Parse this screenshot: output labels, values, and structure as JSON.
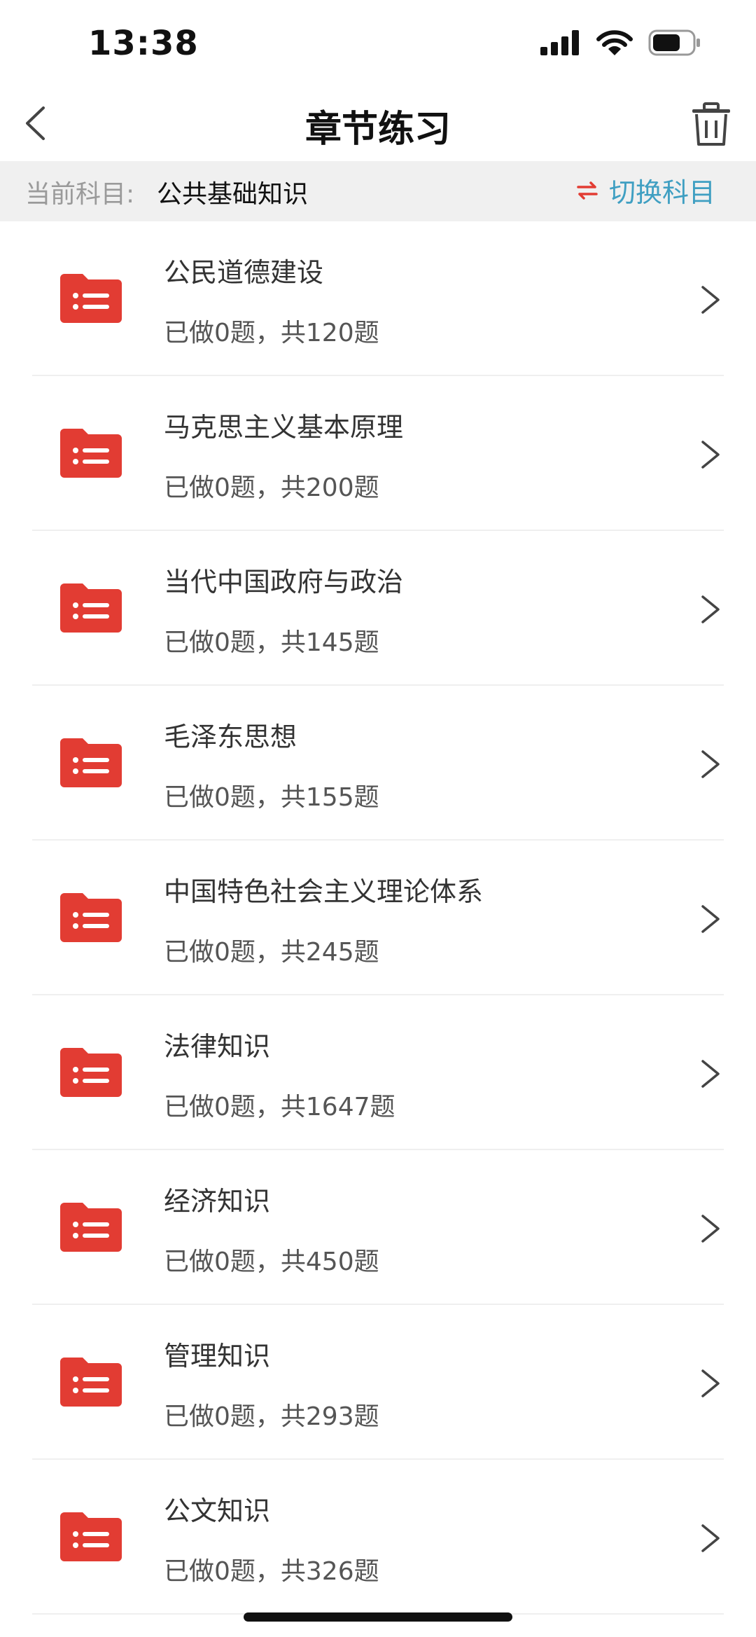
{
  "status_bar": {
    "time": "13:38"
  },
  "nav": {
    "title": "章节练习"
  },
  "subject": {
    "label": "当前科目:",
    "value": "公共基础知识",
    "switch_label": "切换科目"
  },
  "colors": {
    "accent_red": "#e23c33",
    "accent_blue": "#3f9fc2"
  },
  "chapters": [
    {
      "title": "公民道德建设",
      "progress": "已做0题，共120题"
    },
    {
      "title": "马克思主义基本原理",
      "progress": "已做0题，共200题"
    },
    {
      "title": "当代中国政府与政治",
      "progress": "已做0题，共145题"
    },
    {
      "title": "毛泽东思想",
      "progress": "已做0题，共155题"
    },
    {
      "title": "中国特色社会主义理论体系",
      "progress": "已做0题，共245题"
    },
    {
      "title": "法律知识",
      "progress": "已做0题，共1647题"
    },
    {
      "title": "经济知识",
      "progress": "已做0题，共450题"
    },
    {
      "title": "管理知识",
      "progress": "已做0题，共293题"
    },
    {
      "title": "公文知识",
      "progress": "已做0题，共326题"
    }
  ]
}
